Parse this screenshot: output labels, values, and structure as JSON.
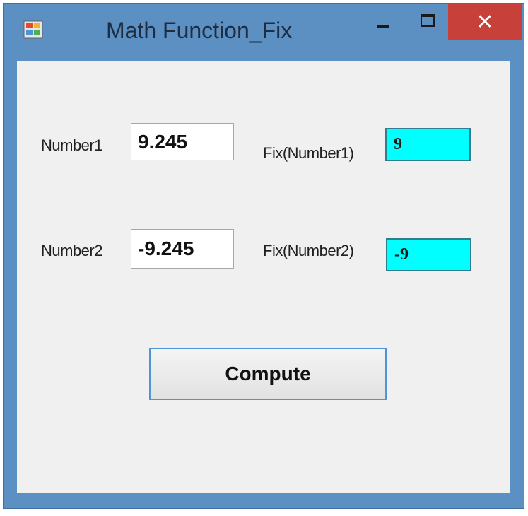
{
  "window": {
    "title": "Math Function_Fix",
    "close_glyph": "✕",
    "app_icon": "windows-form-icon",
    "minimize_icon": "minimize-icon",
    "maximize_icon": "maximize-icon",
    "close_icon": "close-icon"
  },
  "form": {
    "number1_label": "Number1",
    "number1_value": "9.245",
    "number2_label": "Number2",
    "number2_value": "-9.245",
    "fix1_label": "Fix(Number1)",
    "fix1_value": "9",
    "fix2_label": "Fix(Number2)",
    "fix2_value": "-9",
    "compute_label": "Compute"
  },
  "colors": {
    "titlebar": "#5c8fc2",
    "close_button": "#c7413a",
    "output_background": "#00ffff",
    "client_background": "#f0f0f0"
  }
}
